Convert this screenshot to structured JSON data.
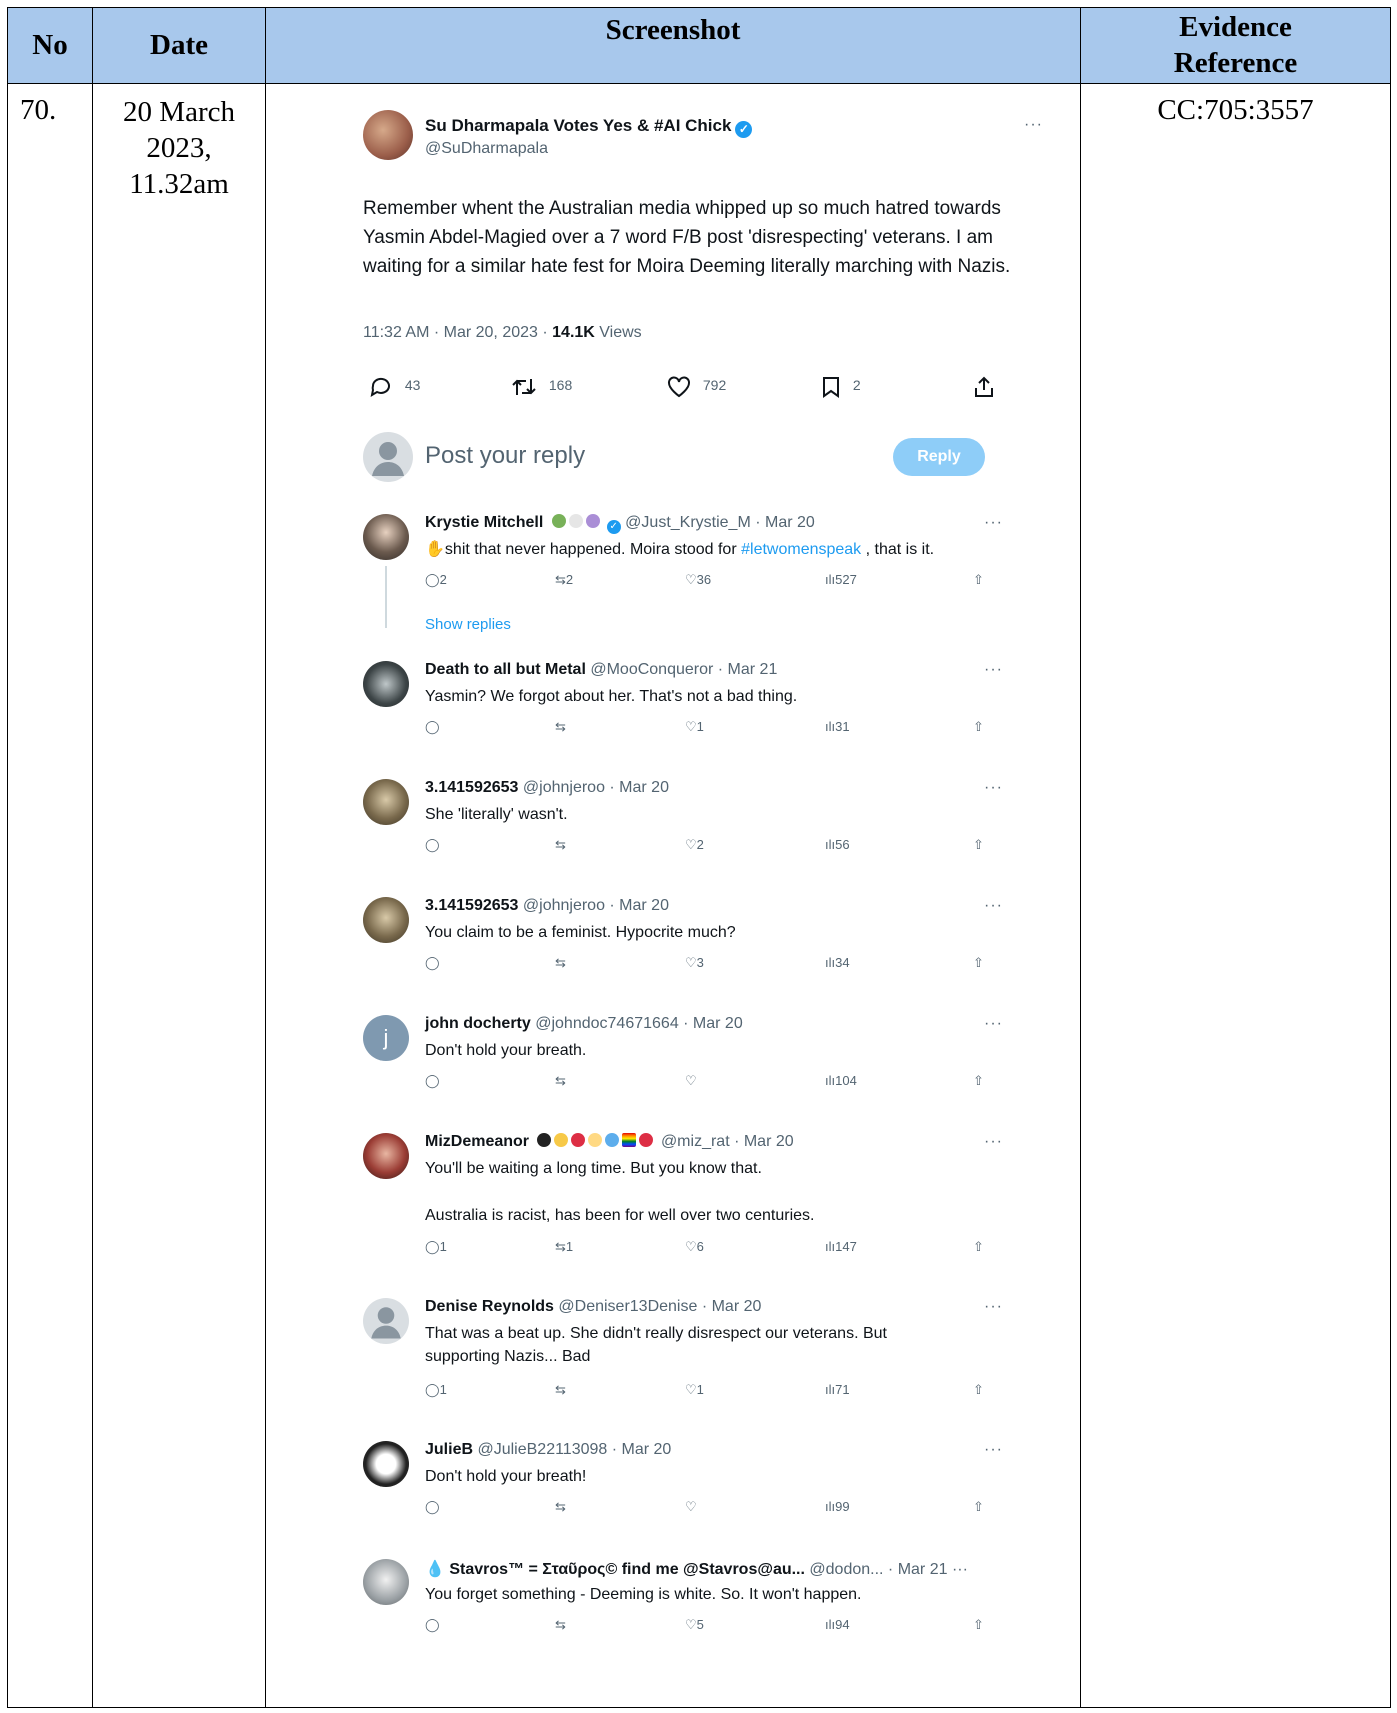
{
  "table": {
    "headers": {
      "no": "No",
      "date": "Date",
      "screenshot": "Screenshot",
      "evidence_line1": "Evidence",
      "evidence_line2": "Reference"
    },
    "row": {
      "no": "70.",
      "date_line1": "20 March",
      "date_line2": "2023,",
      "date_line3": "11.32am",
      "evidence": "CC:705:3557"
    }
  },
  "tweet": {
    "author_name": "Su Dharmapala Votes Yes & #AI Chick",
    "handle": "@SuDharmapala",
    "more": "···",
    "text": "Remember whent the Australian media whipped up so much hatred towards Yasmin Abdel-Magied over a 7 word F/B post 'disrespecting' veterans. I am waiting for a similar hate fest for Moira Deeming literally marching with Nazis.",
    "time": "11:32 AM · Mar 20, 2023 · ",
    "views_count": "14.1K",
    "views_label": " Views",
    "replies": "43",
    "retweets": "168",
    "likes": "792",
    "bookmarks": "2",
    "reply_placeholder": "Post your reply",
    "reply_button": "Reply"
  },
  "replies": [
    {
      "name": "Krystie Mitchell",
      "handle": "@Just_Krystie_M · Mar 20",
      "text_pre": "shit that never happened.  Moira stood for ",
      "hashtag": "#letwomenspeak",
      "text_post": " , that is it.",
      "reply": "2",
      "rt": "2",
      "like": "36",
      "views": "527",
      "show_replies": "Show replies"
    },
    {
      "name": "Death to all but Metal",
      "handle": "@MooConqueror · Mar 21",
      "text": "Yasmin? We forgot about her.  That's not a bad thing.",
      "reply": "",
      "rt": "",
      "like": "1",
      "views": "31"
    },
    {
      "name": "3.141592653",
      "handle": "@johnjeroo · Mar 20",
      "text": "She 'literally' wasn't.",
      "reply": "",
      "rt": "",
      "like": "2",
      "views": "56"
    },
    {
      "name": "3.141592653",
      "handle": "@johnjeroo · Mar 20",
      "text": "You claim to be a feminist. Hypocrite much?",
      "reply": "",
      "rt": "",
      "like": "3",
      "views": "34"
    },
    {
      "name": "john docherty",
      "handle": "@johndoc74671664 · Mar 20",
      "text": "Don't hold your breath.",
      "reply": "",
      "rt": "",
      "like": "",
      "views": "104",
      "avatar_letter": "j"
    },
    {
      "name": "MizDemeanor",
      "handle": "@miz_rat · Mar 20",
      "text": "You'll be waiting a long time. But you know that.",
      "text2": "Australia is racist, has been for well over two centuries.",
      "reply": "1",
      "rt": "1",
      "like": "6",
      "views": "147"
    },
    {
      "name": "Denise Reynolds",
      "handle": "@Deniser13Denise · Mar 20",
      "text": "That was a beat up. She didn't really disrespect our veterans. But supporting Nazis... Bad",
      "reply": "1",
      "rt": "",
      "like": "1",
      "views": "71"
    },
    {
      "name": "JulieB",
      "handle": "@JulieB22113098 · Mar 20",
      "text": "Don't hold your breath!",
      "reply": "",
      "rt": "",
      "like": "",
      "views": "99"
    },
    {
      "name": "Stavros™ = Σταῦρος© find me @Stavros@au...",
      "handle": "@dodon... · Mar 21",
      "text": "You forget something  - Deeming is white. So. It won't happen.",
      "reply": "",
      "rt": "",
      "like": "5",
      "views": "94"
    }
  ],
  "colors": {
    "header_bg": "#a8c8ec",
    "link": "#1d9bf0",
    "muted": "#536471"
  }
}
